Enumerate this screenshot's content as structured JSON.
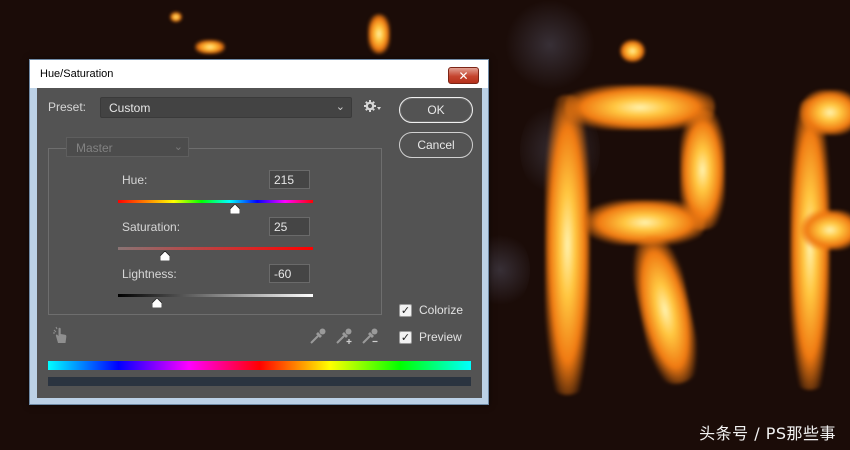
{
  "window": {
    "title": "Hue/Saturation",
    "close_glyph": "✕"
  },
  "preset": {
    "label": "Preset:",
    "value": "Custom",
    "settings_icon": "gear-icon"
  },
  "buttons": {
    "ok": "OK",
    "cancel": "Cancel"
  },
  "channel": {
    "value": "Master"
  },
  "adjustments": {
    "hue": {
      "label": "Hue:",
      "value": "215",
      "level": 0.6
    },
    "saturation": {
      "label": "Saturation:",
      "value": "25",
      "level": 0.24
    },
    "lightness": {
      "label": "Lightness:",
      "value": "-60",
      "level": 0.2
    }
  },
  "options": {
    "colorize": {
      "label": "Colorize",
      "checked": true
    },
    "preview": {
      "label": "Preview",
      "checked": true
    }
  },
  "tools": [
    "targeted-adjustment-icon",
    "eyedropper-icon",
    "eyedropper-add-icon",
    "eyedropper-subtract-icon"
  ],
  "watermark": "头条号 / PS那些事",
  "colors": {
    "panel": "#535353",
    "titlebar": "#ffffff",
    "close": "#c5452f"
  }
}
